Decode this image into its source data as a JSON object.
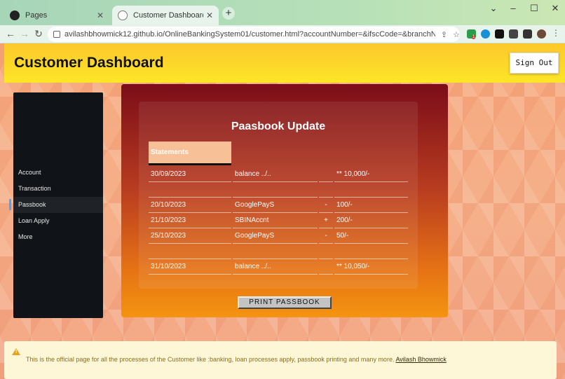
{
  "browser": {
    "tabs": [
      {
        "title": "Pages",
        "favicon": "github-icon"
      },
      {
        "title": "Customer Dashboard",
        "favicon": "globe-icon"
      }
    ],
    "url": "avilashbhowmick12.github.io/OnlineBankingSystem01/customer.html?accountNumber=&ifscCode=&branchName=&name=&am...",
    "extension_badge": "1"
  },
  "header": {
    "title": "Customer Dashboard",
    "signout_label": "Sign Out"
  },
  "sidebar": {
    "items": [
      {
        "label": "Account",
        "active": false
      },
      {
        "label": "Transaction",
        "active": false
      },
      {
        "label": "Passbook",
        "active": true
      },
      {
        "label": "Loan Apply",
        "active": false
      },
      {
        "label": "More",
        "active": false
      }
    ]
  },
  "passbook": {
    "title": "Paasbook Update",
    "header": "Statements",
    "rows": [
      {
        "date": "30/09/2023",
        "desc": "balance ../..",
        "sign": "",
        "amount": "** 10,000/-"
      },
      {
        "date": "",
        "desc": "",
        "sign": "",
        "amount": ""
      },
      {
        "date": "20/10/2023",
        "desc": "GooglePayS",
        "sign": "-",
        "amount": "100/-"
      },
      {
        "date": "21/10/2023",
        "desc": "SBINAccnt",
        "sign": "+",
        "amount": "200/-"
      },
      {
        "date": "25/10/2023",
        "desc": "GooglePayS",
        "sign": "-",
        "amount": "50/-"
      },
      {
        "date": "",
        "desc": "",
        "sign": "",
        "amount": ""
      },
      {
        "date": "31/10/2023",
        "desc": "balance ../..",
        "sign": "",
        "amount": "** 10,050/-"
      }
    ],
    "print_label": "PRINT PASSBOOK"
  },
  "footer": {
    "text": "This is the official page for all the processes of the Customer like :banking, loan processes apply, passbook printing and many more.",
    "link": "Avilash Bhowmick"
  },
  "colors": {
    "header_bg": "#fde628",
    "sidebar_bg": "#101318",
    "panel_top": "#7b0d19",
    "panel_bottom": "#f49410",
    "statements_header": "#f8c096"
  }
}
